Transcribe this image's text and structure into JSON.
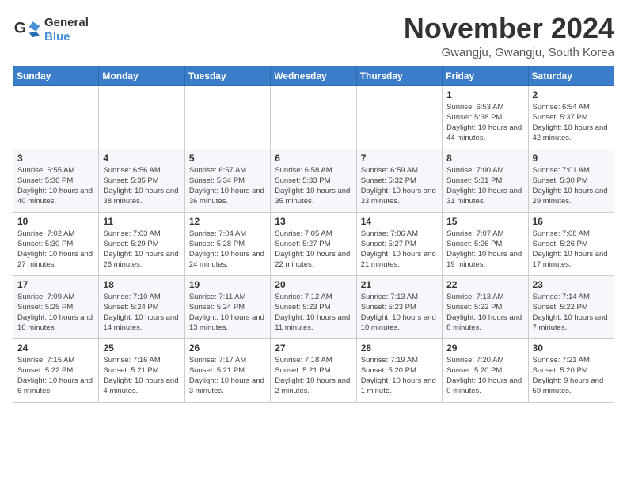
{
  "logo": {
    "line1": "General",
    "line2": "Blue"
  },
  "title": "November 2024",
  "location": "Gwangju, Gwangju, South Korea",
  "days_of_week": [
    "Sunday",
    "Monday",
    "Tuesday",
    "Wednesday",
    "Thursday",
    "Friday",
    "Saturday"
  ],
  "weeks": [
    [
      {
        "day": "",
        "content": ""
      },
      {
        "day": "",
        "content": ""
      },
      {
        "day": "",
        "content": ""
      },
      {
        "day": "",
        "content": ""
      },
      {
        "day": "",
        "content": ""
      },
      {
        "day": "1",
        "content": "Sunrise: 6:53 AM\nSunset: 5:38 PM\nDaylight: 10 hours and 44 minutes."
      },
      {
        "day": "2",
        "content": "Sunrise: 6:54 AM\nSunset: 5:37 PM\nDaylight: 10 hours and 42 minutes."
      }
    ],
    [
      {
        "day": "3",
        "content": "Sunrise: 6:55 AM\nSunset: 5:36 PM\nDaylight: 10 hours and 40 minutes."
      },
      {
        "day": "4",
        "content": "Sunrise: 6:56 AM\nSunset: 5:35 PM\nDaylight: 10 hours and 38 minutes."
      },
      {
        "day": "5",
        "content": "Sunrise: 6:57 AM\nSunset: 5:34 PM\nDaylight: 10 hours and 36 minutes."
      },
      {
        "day": "6",
        "content": "Sunrise: 6:58 AM\nSunset: 5:33 PM\nDaylight: 10 hours and 35 minutes."
      },
      {
        "day": "7",
        "content": "Sunrise: 6:59 AM\nSunset: 5:32 PM\nDaylight: 10 hours and 33 minutes."
      },
      {
        "day": "8",
        "content": "Sunrise: 7:00 AM\nSunset: 5:31 PM\nDaylight: 10 hours and 31 minutes."
      },
      {
        "day": "9",
        "content": "Sunrise: 7:01 AM\nSunset: 5:30 PM\nDaylight: 10 hours and 29 minutes."
      }
    ],
    [
      {
        "day": "10",
        "content": "Sunrise: 7:02 AM\nSunset: 5:30 PM\nDaylight: 10 hours and 27 minutes."
      },
      {
        "day": "11",
        "content": "Sunrise: 7:03 AM\nSunset: 5:29 PM\nDaylight: 10 hours and 26 minutes."
      },
      {
        "day": "12",
        "content": "Sunrise: 7:04 AM\nSunset: 5:28 PM\nDaylight: 10 hours and 24 minutes."
      },
      {
        "day": "13",
        "content": "Sunrise: 7:05 AM\nSunset: 5:27 PM\nDaylight: 10 hours and 22 minutes."
      },
      {
        "day": "14",
        "content": "Sunrise: 7:06 AM\nSunset: 5:27 PM\nDaylight: 10 hours and 21 minutes."
      },
      {
        "day": "15",
        "content": "Sunrise: 7:07 AM\nSunset: 5:26 PM\nDaylight: 10 hours and 19 minutes."
      },
      {
        "day": "16",
        "content": "Sunrise: 7:08 AM\nSunset: 5:26 PM\nDaylight: 10 hours and 17 minutes."
      }
    ],
    [
      {
        "day": "17",
        "content": "Sunrise: 7:09 AM\nSunset: 5:25 PM\nDaylight: 10 hours and 16 minutes."
      },
      {
        "day": "18",
        "content": "Sunrise: 7:10 AM\nSunset: 5:24 PM\nDaylight: 10 hours and 14 minutes."
      },
      {
        "day": "19",
        "content": "Sunrise: 7:11 AM\nSunset: 5:24 PM\nDaylight: 10 hours and 13 minutes."
      },
      {
        "day": "20",
        "content": "Sunrise: 7:12 AM\nSunset: 5:23 PM\nDaylight: 10 hours and 11 minutes."
      },
      {
        "day": "21",
        "content": "Sunrise: 7:13 AM\nSunset: 5:23 PM\nDaylight: 10 hours and 10 minutes."
      },
      {
        "day": "22",
        "content": "Sunrise: 7:13 AM\nSunset: 5:22 PM\nDaylight: 10 hours and 8 minutes."
      },
      {
        "day": "23",
        "content": "Sunrise: 7:14 AM\nSunset: 5:22 PM\nDaylight: 10 hours and 7 minutes."
      }
    ],
    [
      {
        "day": "24",
        "content": "Sunrise: 7:15 AM\nSunset: 5:22 PM\nDaylight: 10 hours and 6 minutes."
      },
      {
        "day": "25",
        "content": "Sunrise: 7:16 AM\nSunset: 5:21 PM\nDaylight: 10 hours and 4 minutes."
      },
      {
        "day": "26",
        "content": "Sunrise: 7:17 AM\nSunset: 5:21 PM\nDaylight: 10 hours and 3 minutes."
      },
      {
        "day": "27",
        "content": "Sunrise: 7:18 AM\nSunset: 5:21 PM\nDaylight: 10 hours and 2 minutes."
      },
      {
        "day": "28",
        "content": "Sunrise: 7:19 AM\nSunset: 5:20 PM\nDaylight: 10 hours and 1 minute."
      },
      {
        "day": "29",
        "content": "Sunrise: 7:20 AM\nSunset: 5:20 PM\nDaylight: 10 hours and 0 minutes."
      },
      {
        "day": "30",
        "content": "Sunrise: 7:21 AM\nSunset: 5:20 PM\nDaylight: 9 hours and 59 minutes."
      }
    ]
  ]
}
